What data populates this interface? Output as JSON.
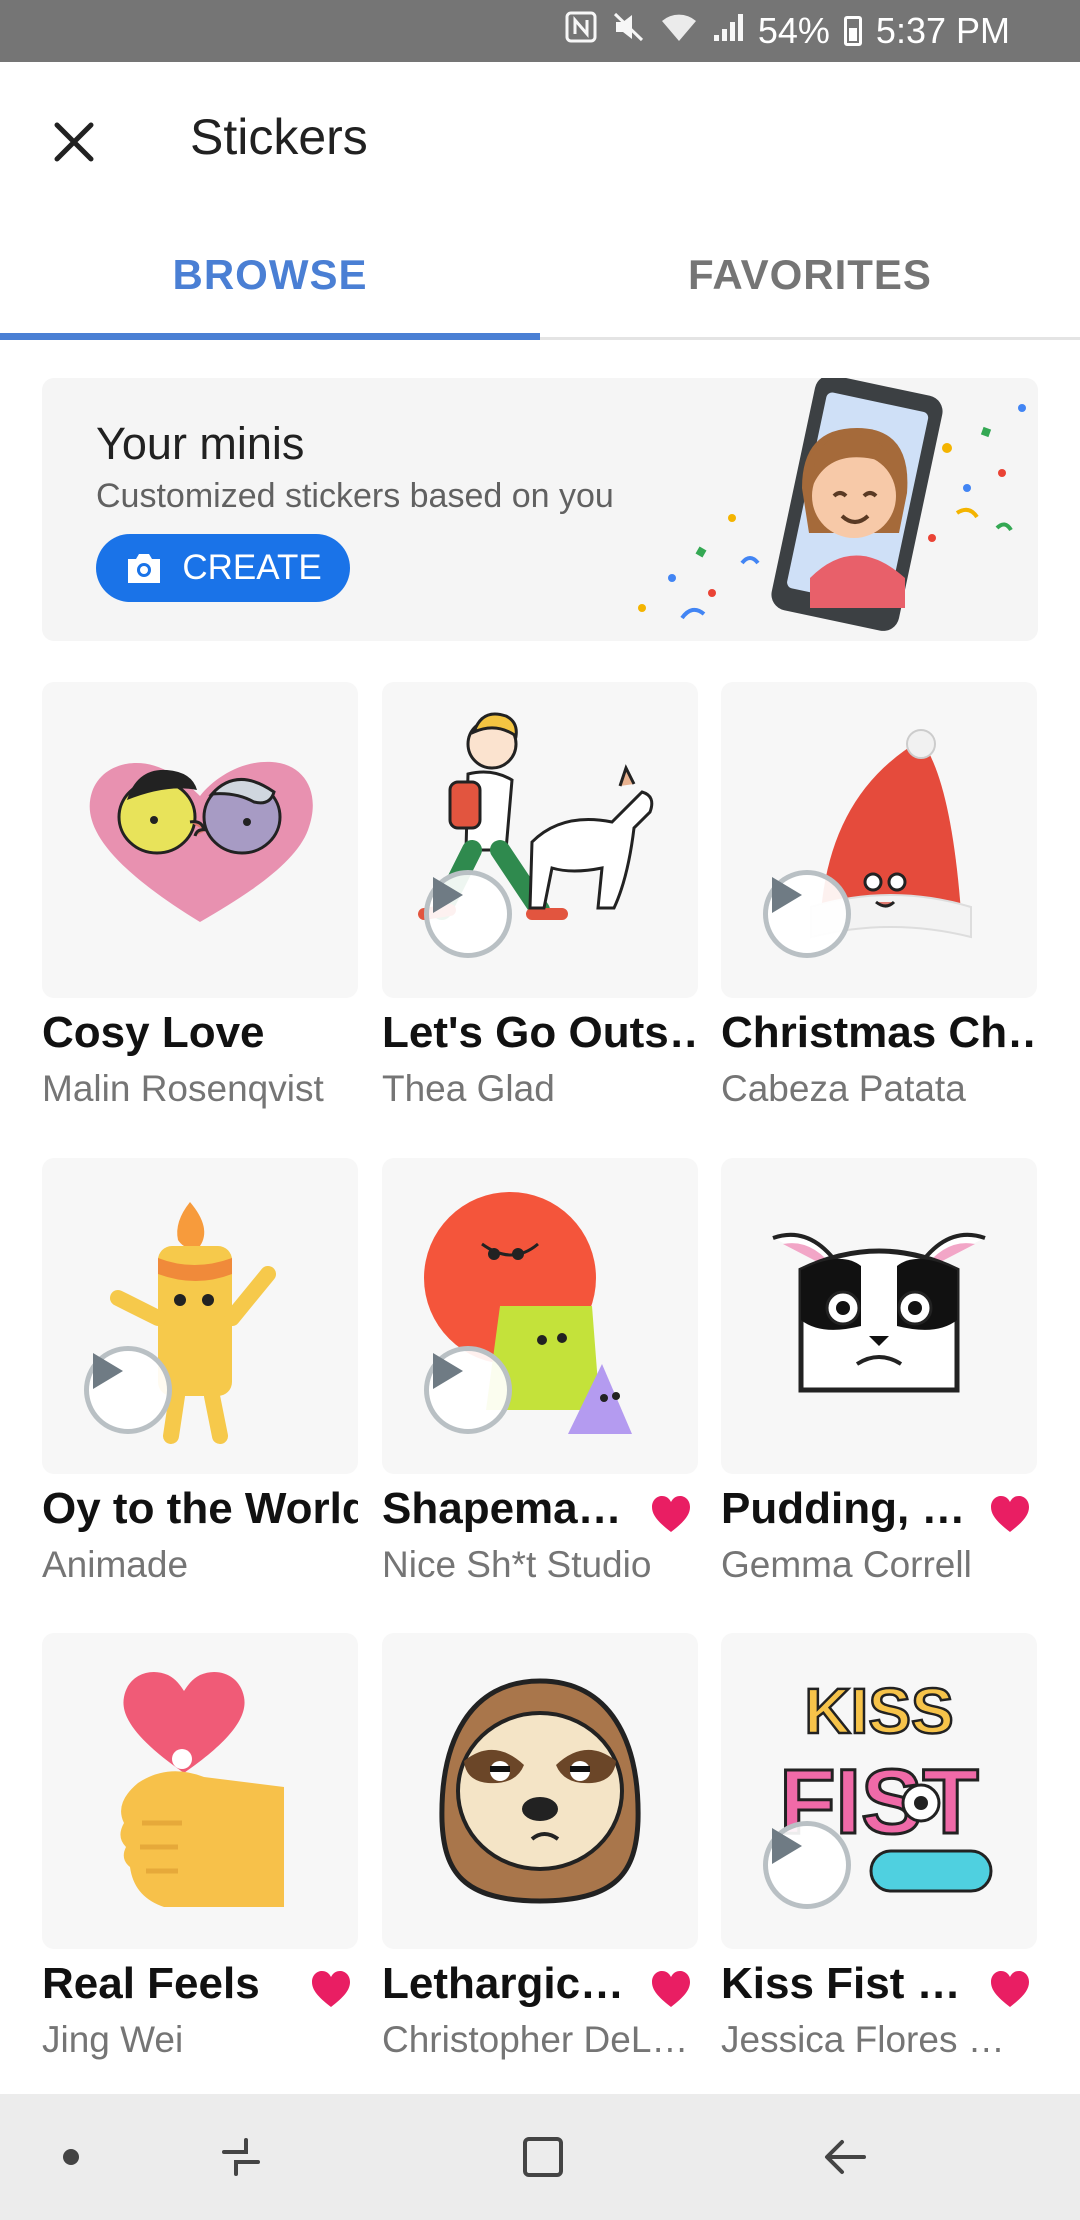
{
  "status_bar": {
    "battery": "54%",
    "time": "5:37 PM",
    "icons": [
      "nfc-icon",
      "mute-icon",
      "wifi-icon",
      "signal-icon",
      "battery-icon"
    ]
  },
  "app_bar": {
    "title": "Stickers",
    "close_icon": "close-icon"
  },
  "tabs": [
    {
      "label": "BROWSE",
      "active": true
    },
    {
      "label": "FAVORITES",
      "active": false
    }
  ],
  "minis": {
    "title": "Your minis",
    "subtitle": "Customized stickers based on you",
    "button_label": "CREATE",
    "button_icon": "camera-icon"
  },
  "packs": [
    {
      "name": "Cosy Love",
      "author": "Malin Rosenqvist",
      "animated": false,
      "favorite": false
    },
    {
      "name": "Let's Go Outs…",
      "author": "Thea Glad",
      "animated": true,
      "favorite": false
    },
    {
      "name": "Christmas Ch…",
      "author": "Cabeza Patata",
      "animated": true,
      "favorite": false
    },
    {
      "name": "Oy to the World",
      "author": "Animade",
      "animated": true,
      "favorite": false
    },
    {
      "name": "Shapema…",
      "author": "Nice Sh*t Studio",
      "animated": true,
      "favorite": true
    },
    {
      "name": "Pudding, …",
      "author": "Gemma Correll",
      "animated": false,
      "favorite": true
    },
    {
      "name": "Real Feels",
      "author": "Jing Wei",
      "animated": false,
      "favorite": true
    },
    {
      "name": "Lethargic…",
      "author": "Christopher DeL…",
      "animated": false,
      "favorite": true
    },
    {
      "name": "Kiss Fist …",
      "author": "Jessica Flores …",
      "animated": true,
      "favorite": true
    }
  ],
  "sticker_art": {
    "kiss_fist_top": "KISS",
    "kiss_fist_bottom": "FIST"
  },
  "colors": {
    "accent": "#4a7fd4",
    "create_button": "#1a73e8",
    "heart": "#e91e63",
    "status_bar": "#757575"
  },
  "nav_bar": {
    "buttons": [
      "dot-icon",
      "recent-apps-icon",
      "home-icon",
      "back-icon"
    ]
  }
}
